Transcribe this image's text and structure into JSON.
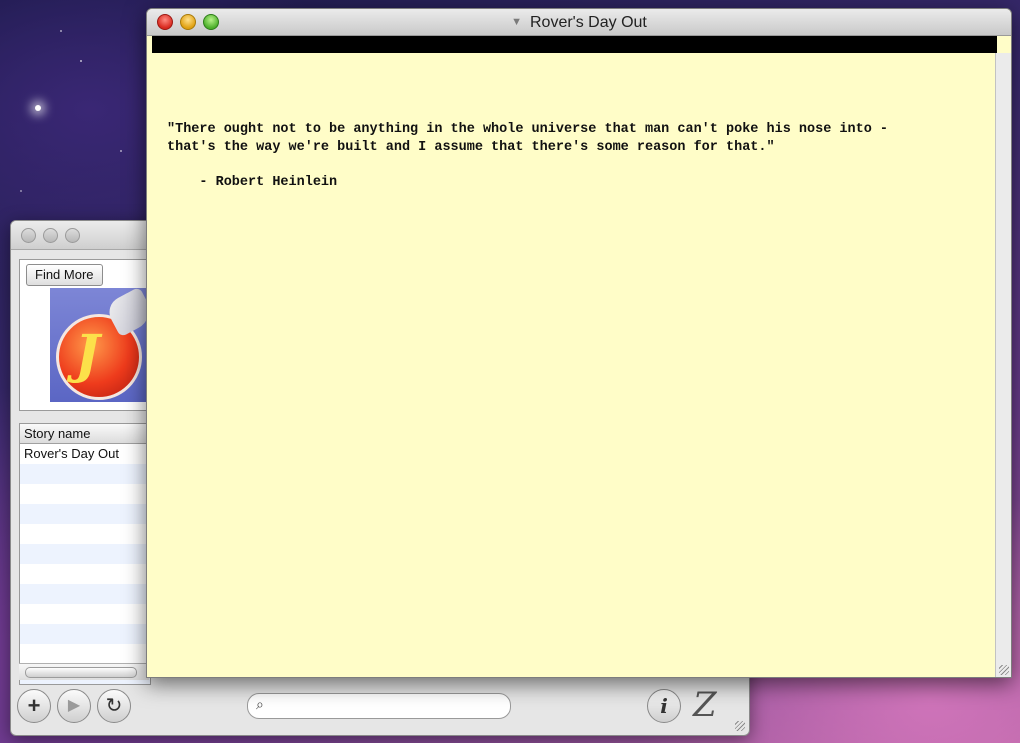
{
  "library_window": {
    "find_more_label": "Find More",
    "story_table": {
      "column_header": "Story name",
      "rows": [
        "Rover's Day Out",
        "",
        "",
        "",
        "",
        "",
        "",
        "",
        "",
        "",
        "",
        ""
      ]
    },
    "toolbar": {
      "add_icon": "+",
      "play_icon": "▶",
      "reload_icon": "↻",
      "search_icon": "⌕",
      "search_value": "",
      "info_icon": "i",
      "logo_text": "Z"
    }
  },
  "story_window": {
    "title": "Rover's Day Out",
    "proxy_icon": "▼",
    "text": {
      "line1": "\"There ought not to be anything in the whole universe that man can't poke his nose into -",
      "line2": "that's the way we're built and I assume that there's some reason for that.\"",
      "line3": "    - Robert Heinlein"
    }
  },
  "colors": {
    "story_background": "#fffdc8",
    "status_bar": "#000000",
    "table_stripe": "#edf3fe"
  }
}
